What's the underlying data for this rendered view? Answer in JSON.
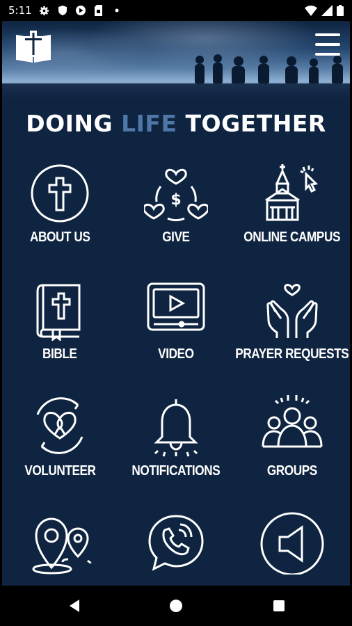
{
  "status_bar": {
    "time": "5:11",
    "left_icons": [
      "gear-icon",
      "shield-icon",
      "play-icon",
      "sim-icon",
      "dot-icon"
    ],
    "right_icons": [
      "wifi-icon",
      "signal-icon",
      "battery-icon"
    ]
  },
  "header": {
    "logo_icon": "bible-cross-logo-icon",
    "menu_icon": "hamburger-menu-icon"
  },
  "tagline": {
    "part1": "DOING ",
    "accent": "LIFE",
    "part2": " TOGETHER",
    "accent_color": "#4e78a8"
  },
  "tiles": [
    {
      "label": "ABOUT US",
      "icon": "cross-circle-icon"
    },
    {
      "label": "GIVE",
      "icon": "give-hearts-icon"
    },
    {
      "label": "ONLINE CAMPUS",
      "icon": "church-cursor-icon"
    },
    {
      "label": "BIBLE",
      "icon": "bible-icon"
    },
    {
      "label": "VIDEO",
      "icon": "video-player-icon"
    },
    {
      "label": "PRAYER REQUESTS",
      "icon": "praying-hands-icon"
    },
    {
      "label": "VOLUNTEER",
      "icon": "heart-ribbon-icon"
    },
    {
      "label": "NOTIFICATIONS",
      "icon": "bell-icon"
    },
    {
      "label": "GROUPS",
      "icon": "group-people-icon"
    },
    {
      "label": "",
      "icon": "location-pins-icon"
    },
    {
      "label": "",
      "icon": "phone-chat-icon"
    },
    {
      "label": "",
      "icon": "megaphone-circle-icon"
    }
  ],
  "nav_bar": {
    "back_icon": "back-triangle-icon",
    "home_icon": "home-circle-icon",
    "recents_icon": "recents-square-icon"
  },
  "colors": {
    "background": "#0f2440",
    "text": "#ffffff",
    "accent": "#4e78a8"
  }
}
